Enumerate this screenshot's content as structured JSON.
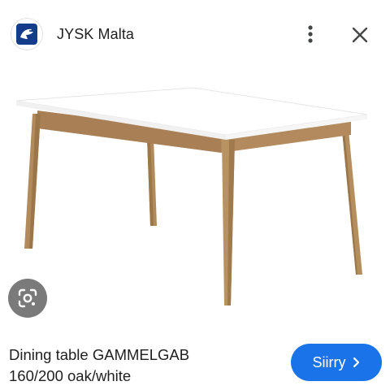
{
  "header": {
    "site_name": "JYSK Malta",
    "logo_icon": "jysk-bird-logo-icon",
    "menu_icon": "more-vert-icon",
    "close_icon": "close-icon"
  },
  "image": {
    "subject": "dining-table-image",
    "lens_icon": "google-lens-icon"
  },
  "product": {
    "title_line1": "Dining table GAMMELGAB",
    "title_line2": "160/200 oak/white"
  },
  "visit_button": {
    "label": "Siirry",
    "icon": "chevron-right-icon",
    "color": "#1a73e8"
  },
  "colors": {
    "logo_bg": "#143c8a",
    "lens_bg": "#7a7a7a"
  }
}
